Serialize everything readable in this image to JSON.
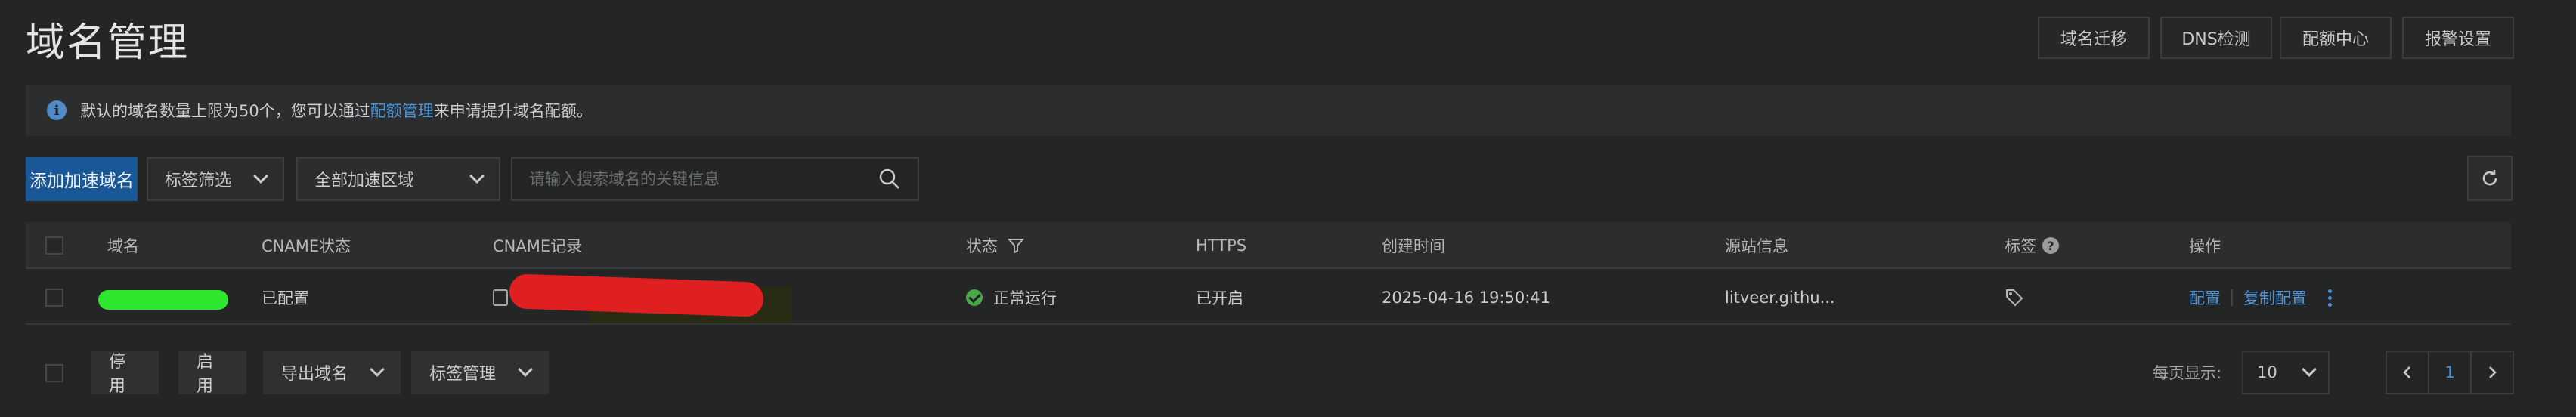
{
  "header": {
    "title": "域名管理",
    "buttons": [
      "域名迁移",
      "DNS检测",
      "配额中心",
      "报警设置"
    ]
  },
  "notice": {
    "text_before": "默认的域名数量上限为50个，您可以通过",
    "link": "配额管理",
    "text_after": "来申请提升域名配额。"
  },
  "toolbar": {
    "add_label": "添加加速域名",
    "tag_filter": "标签筛选",
    "region": "全部加速区域",
    "search_placeholder": "请输入搜索域名的关键信息"
  },
  "table": {
    "headers": {
      "domain": "域名",
      "cname_status": "CNAME状态",
      "cname_record": "CNAME记录",
      "status": "状态",
      "https": "HTTPS",
      "created": "创建时间",
      "origin": "源站信息",
      "tags": "标签",
      "actions": "操作"
    },
    "rows": [
      {
        "cname_status": "已配置",
        "status": "正常运行",
        "https": "已开启",
        "created": "2025-04-16 19:50:41",
        "origin": "litveer.githu...",
        "action_config": "配置",
        "action_copy": "复制配置"
      }
    ]
  },
  "footer": {
    "disable": "停用",
    "enable": "启用",
    "export": "导出域名",
    "tag_manage": "标签管理",
    "per_page_label": "每页显示:",
    "per_page_value": "10",
    "current_page": "1"
  },
  "colors": {
    "primary": "#1a5796",
    "link": "#4e93d8",
    "success": "#4aa74a",
    "redaction_red": "#e02020",
    "redaction_green": "#2ee62e"
  }
}
